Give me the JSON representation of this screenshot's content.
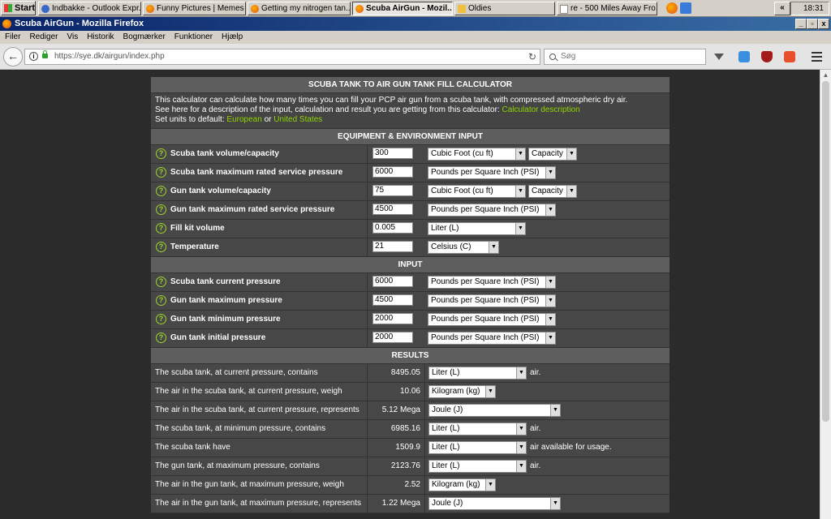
{
  "taskbar": {
    "start": "Start",
    "tasks": [
      "Indbakke - Outlook Expr...",
      "Funny Pictures | Memes ...",
      "Getting my nitrogen tan...",
      "Scuba AirGun - Mozil...",
      "Oldies",
      "re - 500 Miles Away Fro..."
    ],
    "tray_arrow": "«",
    "clock": "18:31"
  },
  "window": {
    "title": "Scuba AirGun - Mozilla Firefox",
    "minimize": "_",
    "maximize": "▫",
    "close": "x"
  },
  "menu": [
    "Filer",
    "Rediger",
    "Vis",
    "Historik",
    "Bogmærker",
    "Funktioner",
    "Hjælp"
  ],
  "nav": {
    "back": "←",
    "url": "https://sye.dk/airgun/index.php",
    "reload": "↻",
    "search_placeholder": "Søg",
    "badge_count": "0"
  },
  "calc": {
    "title": "SCUBA TANK TO AIR GUN TANK FILL CALCULATOR",
    "intro_line1": "This calculator can calculate how many times you can fill your PCP air gun from a scuba tank, with compressed atmospheric dry air.",
    "intro_line2": "See here for a description of the input, calculation and result you are getting from this calculator:",
    "intro_link": "Calculator description",
    "units_prefix": "Set units to default:",
    "units_eu": "European",
    "units_or": "or",
    "units_us": "United States",
    "q_icon": "?",
    "section_equipment": "EQUIPMENT & ENVIRONMENT INPUT",
    "section_input": "INPUT",
    "section_results": "RESULTS",
    "equipment": [
      {
        "label": "Scuba tank volume/capacity",
        "value": "300",
        "unit": "Cubic Foot (cu ft)",
        "extra": "Capacity"
      },
      {
        "label": "Scuba tank maximum rated service pressure",
        "value": "6000",
        "unit": "Pounds per Square Inch (PSI)"
      },
      {
        "label": "Gun tank volume/capacity",
        "value": "75",
        "unit": "Cubic Foot (cu ft)",
        "extra": "Capacity"
      },
      {
        "label": "Gun tank maximum rated service pressure",
        "value": "4500",
        "unit": "Pounds per Square Inch (PSI)"
      },
      {
        "label": "Fill kit volume",
        "value": "0.005",
        "unit": "Liter (L)"
      },
      {
        "label": "Temperature",
        "value": "21",
        "unit": "Celsius (C)"
      }
    ],
    "inputs": [
      {
        "label": "Scuba tank current pressure",
        "value": "6000",
        "unit": "Pounds per Square Inch (PSI)"
      },
      {
        "label": "Gun tank maximum pressure",
        "value": "4500",
        "unit": "Pounds per Square Inch (PSI)"
      },
      {
        "label": "Gun tank minimum pressure",
        "value": "2000",
        "unit": "Pounds per Square Inch (PSI)"
      },
      {
        "label": "Gun tank initial pressure",
        "value": "2000",
        "unit": "Pounds per Square Inch (PSI)"
      }
    ],
    "results": [
      {
        "label": "The scuba tank, at current pressure, contains",
        "value": "8495.05",
        "unit": "Liter (L)",
        "suffix": "air."
      },
      {
        "label": "The air in the scuba tank, at current pressure, weigh",
        "value": "10.06",
        "unit": "Kilogram (kg)",
        "suffix": ""
      },
      {
        "label": "The air in the scuba tank, at current pressure, represents",
        "value": "5.12 Mega",
        "unit": "Joule (J)",
        "suffix": ""
      },
      {
        "label": "The scuba tank, at minimum pressure, contains",
        "value": "6985.16",
        "unit": "Liter (L)",
        "suffix": "air."
      },
      {
        "label": "The scuba tank have",
        "value": "1509.9",
        "unit": "Liter (L)",
        "suffix": "air available for usage."
      },
      {
        "label": "The gun tank, at maximum pressure, contains",
        "value": "2123.76",
        "unit": "Liter (L)",
        "suffix": "air."
      },
      {
        "label": "The air in the gun tank, at maximum pressure, weigh",
        "value": "2.52",
        "unit": "Kilogram (kg)",
        "suffix": ""
      },
      {
        "label": "The air in the gun tank, at maximum pressure, represents",
        "value": "1.22 Mega",
        "unit": "Joule (J)",
        "suffix": ""
      }
    ]
  }
}
